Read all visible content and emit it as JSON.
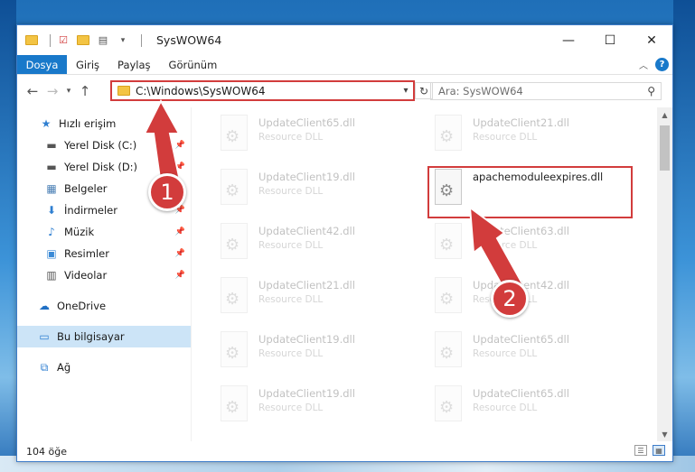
{
  "window": {
    "title": "SysWOW64",
    "controls": {
      "minimize": "—",
      "maximize": "☐",
      "close": "✕"
    }
  },
  "ribbon": {
    "tabs": [
      "Dosya",
      "Giriş",
      "Paylaş",
      "Görünüm"
    ],
    "help": "?"
  },
  "address": {
    "path": "C:\\Windows\\SysWOW64",
    "search_placeholder": "Ara: SysWOW64"
  },
  "sidebar": {
    "items": [
      {
        "label": "Hızlı erişim",
        "icon": "star-icon",
        "pinned": false
      },
      {
        "label": "Yerel Disk (C:)",
        "icon": "drive-icon",
        "pinned": true
      },
      {
        "label": "Yerel Disk (D:)",
        "icon": "drive-icon",
        "pinned": true
      },
      {
        "label": "Belgeler",
        "icon": "document-icon",
        "pinned": true
      },
      {
        "label": "İndirmeler",
        "icon": "download-icon",
        "pinned": true
      },
      {
        "label": "Müzik",
        "icon": "music-icon",
        "pinned": true
      },
      {
        "label": "Resimler",
        "icon": "picture-icon",
        "pinned": true
      },
      {
        "label": "Videolar",
        "icon": "video-icon",
        "pinned": true
      },
      {
        "label": "OneDrive",
        "icon": "cloud-icon",
        "pinned": false
      },
      {
        "label": "Bu bilgisayar",
        "icon": "computer-icon",
        "pinned": false,
        "selected": true
      },
      {
        "label": "Ağ",
        "icon": "network-icon",
        "pinned": false
      }
    ]
  },
  "files": {
    "left": [
      {
        "name": "UpdateClient65.dll",
        "type": "Resource DLL"
      },
      {
        "name": "UpdateClient19.dll",
        "type": "Resource DLL"
      },
      {
        "name": "UpdateClient42.dll",
        "type": "Resource DLL"
      },
      {
        "name": "UpdateClient21.dll",
        "type": "Resource DLL"
      },
      {
        "name": "UpdateClient19.dll",
        "type": "Resource DLL"
      },
      {
        "name": "UpdateClient19.dll",
        "type": "Resource DLL"
      }
    ],
    "right": [
      {
        "name": "UpdateClient21.dll",
        "type": "Resource DLL"
      },
      {
        "name": "apachemoduleexpires.dll",
        "type": ""
      },
      {
        "name": "UpdateClient63.dll",
        "type": "Resource DLL"
      },
      {
        "name": "UpdateClient42.dll",
        "type": "Resource DLL"
      },
      {
        "name": "UpdateClient65.dll",
        "type": "Resource DLL"
      },
      {
        "name": "UpdateClient65.dll",
        "type": "Resource DLL"
      }
    ]
  },
  "status": {
    "count": "104 öğe"
  },
  "annotations": {
    "step1": "1",
    "step2": "2",
    "color": "#d23c3c"
  }
}
